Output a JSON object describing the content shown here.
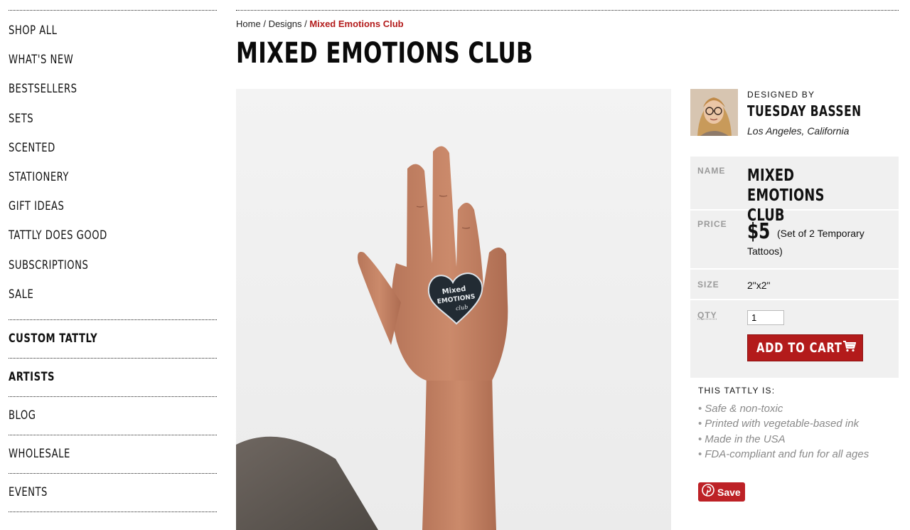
{
  "sidebar": {
    "items": [
      "SHOP ALL",
      "WHAT'S NEW",
      "BESTSELLERS",
      "SETS",
      "SCENTED",
      "STATIONERY",
      "GIFT IDEAS",
      "TATTLY DOES GOOD",
      "SUBSCRIPTIONS",
      "SALE"
    ],
    "custom": "CUSTOM TATTLY",
    "artists": "ARTISTS",
    "blog": "BLOG",
    "wholesale": "WHOLESALE",
    "events": "EVENTS"
  },
  "breadcrumb": {
    "home": "Home",
    "sep1": "/",
    "designs": "Designs",
    "sep2": "/",
    "current": "Mixed Emotions Club"
  },
  "page": {
    "title": "MIXED EMOTIONS CLUB"
  },
  "designer": {
    "designed_by": "DESIGNED BY",
    "name": "TUESDAY BASSEN",
    "location": "Los Angeles, California"
  },
  "specs": {
    "name_label": "NAME",
    "name_value": "MIXED EMOTIONS CLUB",
    "price_label": "PRICE",
    "price_value": "$5",
    "price_note": "(Set of 2 Temporary Tattoos)",
    "size_label": "SIZE",
    "size_value": "2\"x2\"",
    "qty_label": "QTY",
    "qty_value": "1",
    "add_to_cart": "ADD TO CART"
  },
  "features": {
    "title": "THIS TATTLY IS:",
    "items": [
      "Safe & non-toxic",
      "Printed with vegetable-based ink",
      "Made in the USA",
      "FDA-compliant and fun for all ages"
    ]
  },
  "pinterest": {
    "label": "Save"
  },
  "tattoo": {
    "line1": "Mixed",
    "line2": "EMOTIONS",
    "line3": "club"
  },
  "colors": {
    "accent": "#b31b1b",
    "pinterest": "#bd2126",
    "spec_bg": "#f0f0f0"
  },
  "icons": {
    "cart": "cart-icon",
    "pinterest": "pinterest-icon"
  }
}
